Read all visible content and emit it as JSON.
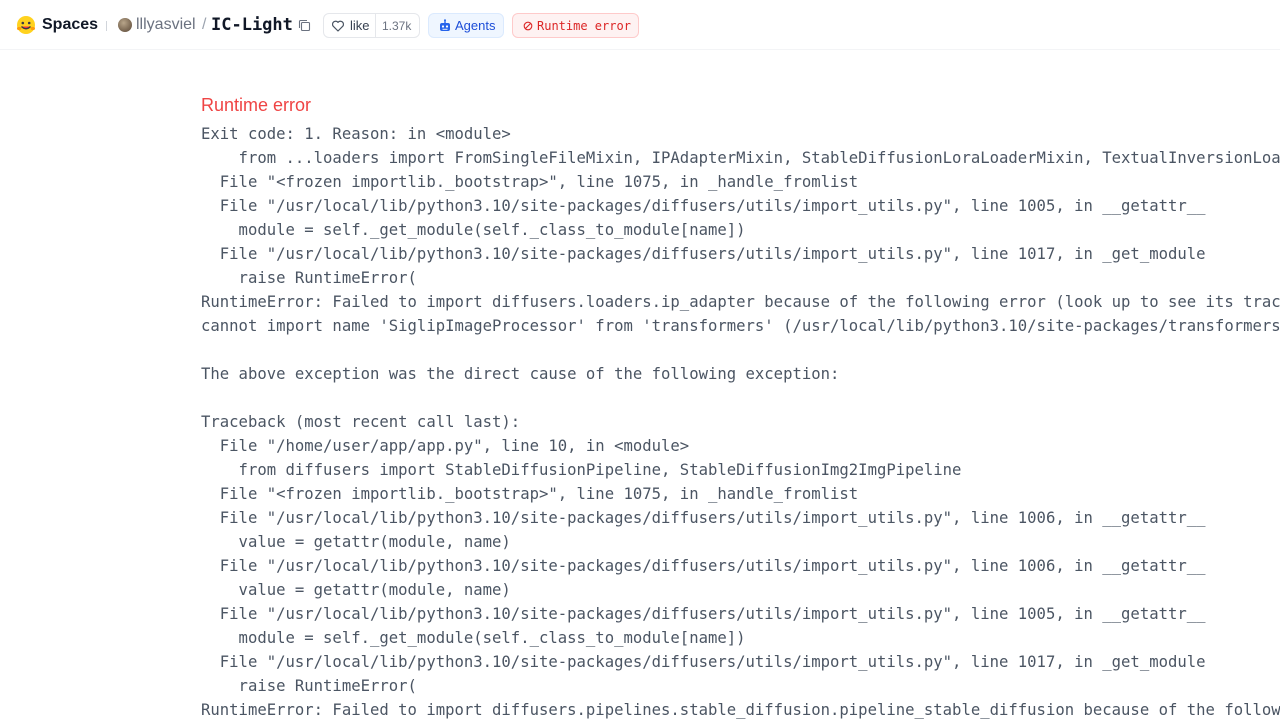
{
  "header": {
    "section": "Spaces",
    "owner": "lllyasviel",
    "separator": "/",
    "repo": "IC-Light",
    "like_label": "like",
    "like_count": "1.37k",
    "agents_label": "Agents",
    "status_label": "Runtime error"
  },
  "colors": {
    "error": "#ef4444",
    "agents": "#1d4ed8"
  },
  "error": {
    "title": "Runtime error",
    "lines": [
      "Exit code: 1. Reason: in <module>",
      "    from ...loaders import FromSingleFileMixin, IPAdapterMixin, StableDiffusionLoraLoaderMixin, TextualInversionLoaderMixin",
      "  File \"<frozen importlib._bootstrap>\", line 1075, in _handle_fromlist",
      "  File \"/usr/local/lib/python3.10/site-packages/diffusers/utils/import_utils.py\", line 1005, in __getattr__",
      "    module = self._get_module(self._class_to_module[name])",
      "  File \"/usr/local/lib/python3.10/site-packages/diffusers/utils/import_utils.py\", line 1017, in _get_module",
      "    raise RuntimeError(",
      "RuntimeError: Failed to import diffusers.loaders.ip_adapter because of the following error (look up to see its traceback):",
      "cannot import name 'SiglipImageProcessor' from 'transformers' (/usr/local/lib/python3.10/site-packages/transformers/__init__.py)",
      "",
      "The above exception was the direct cause of the following exception:",
      "",
      "Traceback (most recent call last):",
      "  File \"/home/user/app/app.py\", line 10, in <module>",
      "    from diffusers import StableDiffusionPipeline, StableDiffusionImg2ImgPipeline",
      "  File \"<frozen importlib._bootstrap>\", line 1075, in _handle_fromlist",
      "  File \"/usr/local/lib/python3.10/site-packages/diffusers/utils/import_utils.py\", line 1006, in __getattr__",
      "    value = getattr(module, name)",
      "  File \"/usr/local/lib/python3.10/site-packages/diffusers/utils/import_utils.py\", line 1006, in __getattr__",
      "    value = getattr(module, name)",
      "  File \"/usr/local/lib/python3.10/site-packages/diffusers/utils/import_utils.py\", line 1005, in __getattr__",
      "    module = self._get_module(self._class_to_module[name])",
      "  File \"/usr/local/lib/python3.10/site-packages/diffusers/utils/import_utils.py\", line 1017, in _get_module",
      "    raise RuntimeError(",
      "RuntimeError: Failed to import diffusers.pipelines.stable_diffusion.pipeline_stable_diffusion because of the following error"
    ]
  }
}
